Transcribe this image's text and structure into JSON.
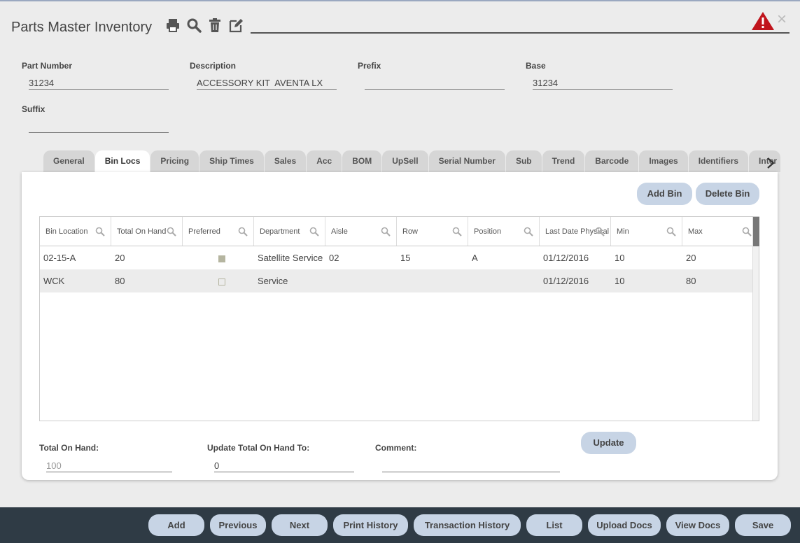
{
  "window": {
    "title": "Parts Master Inventory",
    "close_glyph": "×",
    "toolbar_icons": [
      "print-icon",
      "search-icon",
      "trash-icon",
      "edit-icon"
    ],
    "warning_icon": "warning-icon",
    "warning_color": "#c0141c"
  },
  "fields": {
    "part_number": {
      "label": "Part Number",
      "value": "31234"
    },
    "description": {
      "label": "Description",
      "value": "ACCESSORY KIT  AVENTA LX"
    },
    "prefix": {
      "label": "Prefix",
      "value": ""
    },
    "base": {
      "label": "Base",
      "value": "31234"
    },
    "suffix": {
      "label": "Suffix",
      "value": ""
    }
  },
  "tabs": [
    {
      "label": "General",
      "active": false
    },
    {
      "label": "Bin Locs",
      "active": true
    },
    {
      "label": "Pricing",
      "active": false
    },
    {
      "label": "Ship Times",
      "active": false
    },
    {
      "label": "Sales",
      "active": false
    },
    {
      "label": "Acc",
      "active": false
    },
    {
      "label": "BOM",
      "active": false
    },
    {
      "label": "UpSell",
      "active": false
    },
    {
      "label": "Serial Number",
      "active": false
    },
    {
      "label": "Sub",
      "active": false
    },
    {
      "label": "Trend",
      "active": false
    },
    {
      "label": "Barcode",
      "active": false
    },
    {
      "label": "Images",
      "active": false
    },
    {
      "label": "Identifiers",
      "active": false
    },
    {
      "label": "Inter",
      "active": false
    }
  ],
  "panel": {
    "add_bin": "Add Bin",
    "delete_bin": "Delete Bin",
    "update": "Update"
  },
  "grid": {
    "columns": [
      "Bin Location",
      "Total On Hand",
      "Preferred",
      "Department",
      "Aisle",
      "Row",
      "Position",
      "Last Date Physical",
      "Min",
      "Max"
    ],
    "rows": [
      {
        "bin": "02-15-A",
        "total": "20",
        "preferred": true,
        "department": "Satellite Service",
        "aisle": "02",
        "row": "15",
        "position": "A",
        "last_date": "01/12/2016",
        "min": "10",
        "max": "20"
      },
      {
        "bin": "WCK",
        "total": "80",
        "preferred": false,
        "department": "Service",
        "aisle": "",
        "row": "",
        "position": "",
        "last_date": "01/12/2016",
        "min": "10",
        "max": "80"
      }
    ]
  },
  "bottom_fields": {
    "total_on_hand": {
      "label": "Total On Hand:",
      "value": "100"
    },
    "update_total": {
      "label": "Update Total On Hand To:",
      "value": "0"
    },
    "comment": {
      "label": "Comment:",
      "value": ""
    }
  },
  "footer_buttons": [
    "Add",
    "Previous",
    "Next",
    "Print History",
    "Transaction History",
    "List",
    "Upload Docs",
    "View Docs",
    "Save"
  ]
}
